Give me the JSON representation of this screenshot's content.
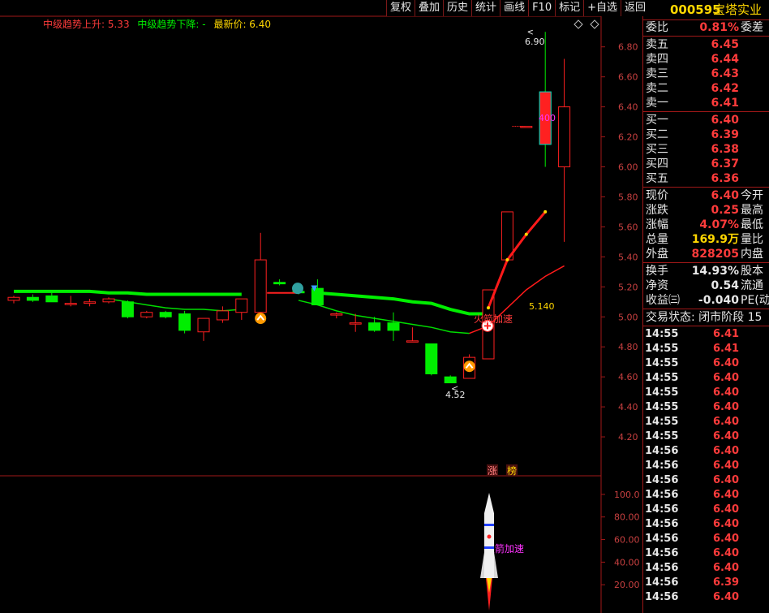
{
  "toolbar": [
    "复权",
    "叠加",
    "历史",
    "统计",
    "画线",
    "F10",
    "标记",
    "+自选",
    "返回"
  ],
  "legend": {
    "up_label": "中级趋势上升: 5.33",
    "down_label": "中级趋势下降: -",
    "latest_label": "最新价: 6.40"
  },
  "colors": {
    "up": "#ff2020",
    "down": "#00ee00",
    "axis": "#a01818",
    "grid_text": "#c84040"
  },
  "price_axis": {
    "ticks": [
      6.8,
      6.6,
      6.4,
      6.2,
      6.0,
      5.8,
      5.6,
      5.4,
      5.2,
      5.0,
      4.8,
      4.6,
      4.4,
      4.2
    ],
    "ymin": 4.0,
    "ymax": 6.95
  },
  "sub_axis": {
    "ticks": [
      100.0,
      80.0,
      60.0,
      40.0,
      20.0
    ],
    "ymin": 0,
    "ymax": 110
  },
  "annotations": {
    "high": "6.90",
    "low": "4.52",
    "mid": "5.140",
    "vol_mark": "400",
    "rocket_signal": "火箭加速",
    "rocket_signal_sub": "火箭加速",
    "tag_zhang": "涨",
    "tag_bang": "榜"
  },
  "chart_data": {
    "type": "candlestick",
    "candles": [
      {
        "o": 5.11,
        "h": 5.14,
        "l": 5.09,
        "c": 5.13
      },
      {
        "o": 5.13,
        "h": 5.15,
        "l": 5.1,
        "c": 5.11
      },
      {
        "o": 5.14,
        "h": 5.16,
        "l": 5.1,
        "c": 5.1
      },
      {
        "o": 5.09,
        "h": 5.14,
        "l": 5.07,
        "c": 5.09
      },
      {
        "o": 5.09,
        "h": 5.12,
        "l": 5.07,
        "c": 5.1
      },
      {
        "o": 5.1,
        "h": 5.13,
        "l": 5.09,
        "c": 5.12
      },
      {
        "o": 5.1,
        "h": 5.11,
        "l": 4.99,
        "c": 5.0
      },
      {
        "o": 5.0,
        "h": 5.04,
        "l": 4.99,
        "c": 5.03
      },
      {
        "o": 5.03,
        "h": 5.04,
        "l": 4.99,
        "c": 5.0
      },
      {
        "o": 5.02,
        "h": 5.04,
        "l": 4.89,
        "c": 4.91
      },
      {
        "o": 4.9,
        "h": 4.99,
        "l": 4.84,
        "c": 4.99
      },
      {
        "o": 4.98,
        "h": 5.07,
        "l": 4.96,
        "c": 5.04
      },
      {
        "o": 5.03,
        "h": 5.12,
        "l": 4.98,
        "c": 5.12
      },
      {
        "o": 5.03,
        "h": 5.56,
        "l": 5.02,
        "c": 5.38
      },
      {
        "o": 5.23,
        "h": 5.25,
        "l": 5.21,
        "c": 5.22
      },
      {
        "o": 5.17,
        "h": 5.18,
        "l": 5.15,
        "c": 5.16
      },
      {
        "o": 5.19,
        "h": 5.25,
        "l": 5.08,
        "c": 5.08
      },
      {
        "o": 5.02,
        "h": 5.03,
        "l": 4.99,
        "c": 5.02
      },
      {
        "o": 4.96,
        "h": 5.02,
        "l": 4.9,
        "c": 4.96
      },
      {
        "o": 4.96,
        "h": 5.0,
        "l": 4.9,
        "c": 4.91
      },
      {
        "o": 4.96,
        "h": 5.03,
        "l": 4.84,
        "c": 4.91
      },
      {
        "o": 4.84,
        "h": 4.93,
        "l": 4.84,
        "c": 4.84
      },
      {
        "o": 4.82,
        "h": 4.82,
        "l": 4.61,
        "c": 4.62
      },
      {
        "o": 4.6,
        "h": 4.61,
        "l": 4.56,
        "c": 4.56
      },
      {
        "o": 4.59,
        "h": 4.75,
        "l": 4.59,
        "c": 4.73
      },
      {
        "o": 4.72,
        "h": 5.18,
        "l": 4.72,
        "c": 5.18
      },
      {
        "o": 5.38,
        "h": 5.7,
        "l": 5.38,
        "c": 5.7
      },
      {
        "o": 6.27,
        "h": 6.26,
        "l": 6.27,
        "c": 6.27
      },
      {
        "o": 6.5,
        "h": 6.9,
        "l": 6.0,
        "c": 6.15
      },
      {
        "o": 6.0,
        "h": 6.72,
        "l": 5.5,
        "c": 6.4
      }
    ],
    "green_line": [
      5.17,
      5.17,
      5.17,
      5.17,
      5.17,
      5.16,
      5.16,
      5.15,
      5.15,
      5.15,
      5.15,
      5.15,
      5.15,
      null,
      null,
      null,
      5.16,
      5.15,
      5.14,
      5.13,
      5.12,
      5.1,
      5.09,
      5.05,
      5.02,
      5.02
    ],
    "ma_line": [
      null,
      null,
      null,
      null,
      null,
      5.12,
      5.1,
      5.08,
      5.06,
      5.05,
      5.05,
      5.04,
      5.05,
      null,
      null,
      5.11,
      5.08,
      5.04,
      5.01,
      4.99,
      4.97,
      4.95,
      4.93,
      4.9,
      4.89
    ],
    "red_line_x": [
      25,
      26,
      27,
      28,
      29
    ],
    "red_line": [
      5.06,
      5.38,
      5.55,
      5.7,
      null
    ],
    "red_thin_x": [
      24,
      25,
      26,
      27,
      28,
      29
    ],
    "red_thin": [
      4.89,
      4.94,
      5.06,
      5.18,
      5.27,
      5.34
    ],
    "sub_rocket_index": 25
  },
  "panel": {
    "code": "000595",
    "name": "宝塔实业",
    "weibi": {
      "label": "委比",
      "value": "0.81%",
      "right": "委差"
    },
    "sells": [
      {
        "label": "卖五",
        "value": "6.45"
      },
      {
        "label": "卖四",
        "value": "6.44"
      },
      {
        "label": "卖三",
        "value": "6.43"
      },
      {
        "label": "卖二",
        "value": "6.42"
      },
      {
        "label": "卖一",
        "value": "6.41"
      }
    ],
    "buys": [
      {
        "label": "买一",
        "value": "6.40"
      },
      {
        "label": "买二",
        "value": "6.39"
      },
      {
        "label": "买三",
        "value": "6.38"
      },
      {
        "label": "买四",
        "value": "6.37"
      },
      {
        "label": "买五",
        "value": "6.36"
      }
    ],
    "quote1": [
      {
        "label": "现价",
        "value": "6.40",
        "right": "今开",
        "color": "red"
      },
      {
        "label": "涨跌",
        "value": "0.25",
        "right": "最高",
        "color": "red"
      },
      {
        "label": "涨幅",
        "value": "4.07%",
        "right": "最低",
        "color": "red"
      },
      {
        "label": "总量",
        "value": "169.9万",
        "right": "量比",
        "color": "yel"
      },
      {
        "label": "外盘",
        "value": "828205",
        "right": "内盘",
        "color": "red"
      }
    ],
    "quote2": [
      {
        "label": "换手",
        "value": "14.93%",
        "right": "股本",
        "color": "wht"
      },
      {
        "label": "净资",
        "value": "0.54",
        "right": "流通",
        "color": "wht"
      },
      {
        "label": "收益㈢",
        "value": "-0.040",
        "right": "PE(动",
        "color": "wht"
      }
    ],
    "trade_status": "交易状态: 闭市阶段 15",
    "ticks": [
      {
        "t": "14:55",
        "p": "6.41"
      },
      {
        "t": "14:55",
        "p": "6.41"
      },
      {
        "t": "14:55",
        "p": "6.40"
      },
      {
        "t": "14:55",
        "p": "6.40"
      },
      {
        "t": "14:55",
        "p": "6.40"
      },
      {
        "t": "14:55",
        "p": "6.40"
      },
      {
        "t": "14:55",
        "p": "6.40"
      },
      {
        "t": "14:55",
        "p": "6.40"
      },
      {
        "t": "14:56",
        "p": "6.40"
      },
      {
        "t": "14:56",
        "p": "6.40"
      },
      {
        "t": "14:56",
        "p": "6.40"
      },
      {
        "t": "14:56",
        "p": "6.40"
      },
      {
        "t": "14:56",
        "p": "6.40"
      },
      {
        "t": "14:56",
        "p": "6.40"
      },
      {
        "t": "14:56",
        "p": "6.40"
      },
      {
        "t": "14:56",
        "p": "6.40"
      },
      {
        "t": "14:56",
        "p": "6.40"
      },
      {
        "t": "14:56",
        "p": "6.39"
      },
      {
        "t": "14:56",
        "p": "6.40"
      }
    ]
  }
}
